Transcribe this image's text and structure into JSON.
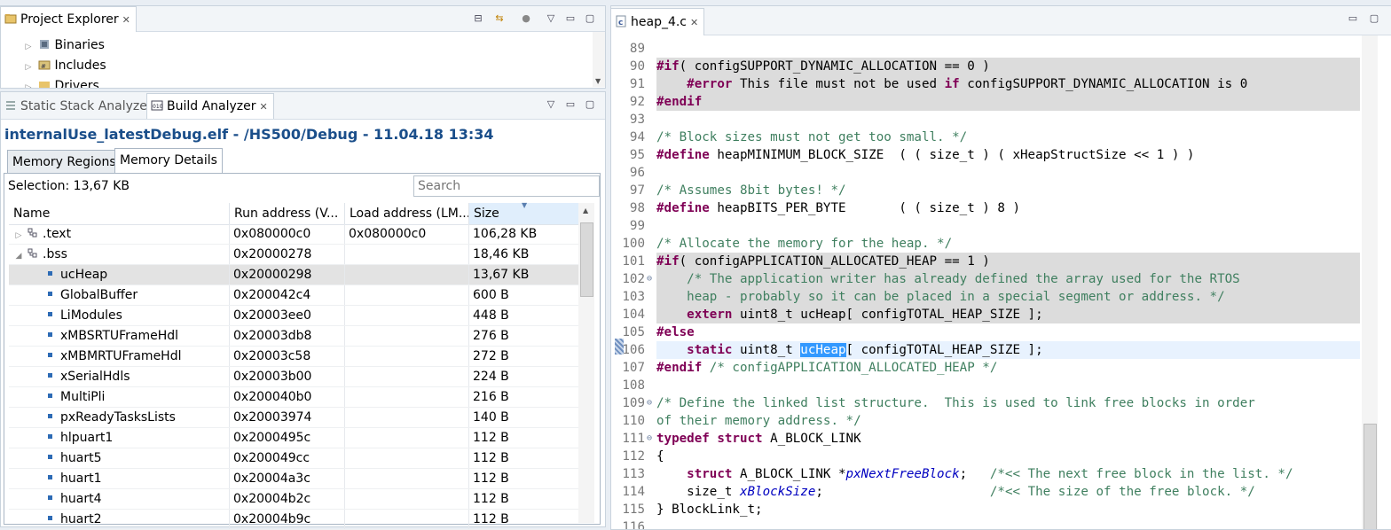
{
  "project_explorer": {
    "title": "Project Explorer",
    "items": [
      {
        "label": "Binaries",
        "icon": "binaries-icon"
      },
      {
        "label": "Includes",
        "icon": "includes-icon"
      },
      {
        "label": "Drivers",
        "icon": "folder-icon"
      }
    ]
  },
  "analyzer": {
    "tabs": [
      "Static Stack Analyzer",
      "Build Analyzer"
    ],
    "file_title": "internalUse_latestDebug.elf - /HS500/Debug - 11.04.18 13:34",
    "subtabs": [
      "Memory Regions",
      "Memory Details"
    ],
    "selection": "Selection: 13,67 KB",
    "search_placeholder": "Search",
    "columns": [
      "Name",
      "Run address (V...",
      "Load address (LM...",
      "Size"
    ],
    "rows": [
      {
        "name": ".text",
        "run": "0x080000c0",
        "load": "0x080000c0",
        "size": "106,28 KB",
        "kind": "section",
        "expanded": false
      },
      {
        "name": ".bss",
        "run": "0x20000278",
        "load": "",
        "size": "18,46 KB",
        "kind": "section",
        "expanded": true
      },
      {
        "name": "ucHeap",
        "run": "0x20000298",
        "load": "",
        "size": "13,67 KB",
        "kind": "symbol",
        "selected": true
      },
      {
        "name": "GlobalBuffer",
        "run": "0x200042c4",
        "load": "",
        "size": "600 B",
        "kind": "symbol"
      },
      {
        "name": "LiModules",
        "run": "0x20003ee0",
        "load": "",
        "size": "448 B",
        "kind": "symbol"
      },
      {
        "name": "xMBSRTUFrameHdl",
        "run": "0x20003db8",
        "load": "",
        "size": "276 B",
        "kind": "symbol"
      },
      {
        "name": "xMBMRTUFrameHdl",
        "run": "0x20003c58",
        "load": "",
        "size": "272 B",
        "kind": "symbol"
      },
      {
        "name": "xSerialHdls",
        "run": "0x20003b00",
        "load": "",
        "size": "224 B",
        "kind": "symbol"
      },
      {
        "name": "MultiPli",
        "run": "0x200040b0",
        "load": "",
        "size": "216 B",
        "kind": "symbol"
      },
      {
        "name": "pxReadyTasksLists",
        "run": "0x20003974",
        "load": "",
        "size": "140 B",
        "kind": "symbol"
      },
      {
        "name": "hlpuart1",
        "run": "0x2000495c",
        "load": "",
        "size": "112 B",
        "kind": "symbol"
      },
      {
        "name": "huart5",
        "run": "0x200049cc",
        "load": "",
        "size": "112 B",
        "kind": "symbol"
      },
      {
        "name": "huart1",
        "run": "0x20004a3c",
        "load": "",
        "size": "112 B",
        "kind": "symbol"
      },
      {
        "name": "huart4",
        "run": "0x20004b2c",
        "load": "",
        "size": "112 B",
        "kind": "symbol"
      },
      {
        "name": "huart2",
        "run": "0x20004b9c",
        "load": "",
        "size": "112 B",
        "kind": "symbol"
      }
    ]
  },
  "editor": {
    "tab": "heap_4.c",
    "lines": [
      {
        "n": "89",
        "hl": false,
        "html": ""
      },
      {
        "n": "90",
        "hl": true,
        "html": "<span class='kw'>#if</span>( configSUPPORT_DYNAMIC_ALLOCATION == 0 )"
      },
      {
        "n": "91",
        "hl": true,
        "html": "    <span class='kw'>#error</span> This file must not be used <span class='kw'>if</span> configSUPPORT_DYNAMIC_ALLOCATION is 0"
      },
      {
        "n": "92",
        "hl": true,
        "html": "<span class='kw'>#endif</span>"
      },
      {
        "n": "93",
        "hl": false,
        "html": ""
      },
      {
        "n": "94",
        "hl": false,
        "html": "<span class='cm'>/* Block sizes must not get too small. */</span>"
      },
      {
        "n": "95",
        "hl": false,
        "html": "<span class='kw'>#define</span> heapMINIMUM_BLOCK_SIZE  ( ( size_t ) ( xHeapStructSize &lt;&lt; 1 ) )"
      },
      {
        "n": "96",
        "hl": false,
        "html": ""
      },
      {
        "n": "97",
        "hl": false,
        "html": "<span class='cm'>/* Assumes 8bit bytes! */</span>"
      },
      {
        "n": "98",
        "hl": false,
        "html": "<span class='kw'>#define</span> heapBITS_PER_BYTE       ( ( size_t ) 8 )"
      },
      {
        "n": "99",
        "hl": false,
        "html": ""
      },
      {
        "n": "100",
        "hl": false,
        "html": "<span class='cm'>/* Allocate the memory for the heap. */</span>"
      },
      {
        "n": "101",
        "hl": true,
        "html": "<span class='kw'>#if</span>( configAPPLICATION_ALLOCATED_HEAP == 1 )"
      },
      {
        "n": "102",
        "hl": true,
        "fold": true,
        "html": "    <span class='cm'>/* The application writer has already defined the array used for the RTOS</span>"
      },
      {
        "n": "103",
        "hl": true,
        "html": "<span class='cm'>    heap - probably so it can be placed in a special segment or address. */</span>"
      },
      {
        "n": "104",
        "hl": true,
        "html": "    <span class='kw'>extern</span> uint8_t ucHeap[ configTOTAL_HEAP_SIZE ];"
      },
      {
        "n": "105",
        "hl": false,
        "html": "<span class='kw'>#else</span>"
      },
      {
        "n": "106",
        "cur": true,
        "html": "    <span class='kw'>static</span> uint8_t <span class='mark'>ucHeap</span>[ configTOTAL_HEAP_SIZE ];"
      },
      {
        "n": "107",
        "hl": false,
        "html": "<span class='kw'>#endif</span> <span class='cm'>/* configAPPLICATION_ALLOCATED_HEAP */</span>"
      },
      {
        "n": "108",
        "hl": false,
        "html": ""
      },
      {
        "n": "109",
        "hl": false,
        "fold": true,
        "html": "<span class='cm'>/* Define the linked list structure.  This is used to link free blocks in order</span>"
      },
      {
        "n": "110",
        "hl": false,
        "html": "<span class='cm'>of their memory address. */</span>"
      },
      {
        "n": "111",
        "hl": false,
        "fold": true,
        "html": "<span class='kw'>typedef</span> <span class='kw'>struct</span> A_BLOCK_LINK"
      },
      {
        "n": "112",
        "hl": false,
        "html": "{"
      },
      {
        "n": "113",
        "hl": false,
        "html": "    <span class='kw'>struct</span> A_BLOCK_LINK *<span class='it'>pxNextFreeBlock</span>;   <span class='cm'>/*&lt;&lt; The next free block in the list. */</span>"
      },
      {
        "n": "114",
        "hl": false,
        "html": "    size_t <span class='it'>xBlockSize</span>;                      <span class='cm'>/*&lt;&lt; The size of the free block. */</span>"
      },
      {
        "n": "115",
        "hl": false,
        "html": "} BlockLink_t;"
      },
      {
        "n": "116",
        "hl": false,
        "html": ""
      }
    ]
  },
  "colors": {
    "accent": "#1a4e8a",
    "keyword": "#7f0055",
    "comment": "#3f7f5f",
    "selection": "#3399ff"
  }
}
